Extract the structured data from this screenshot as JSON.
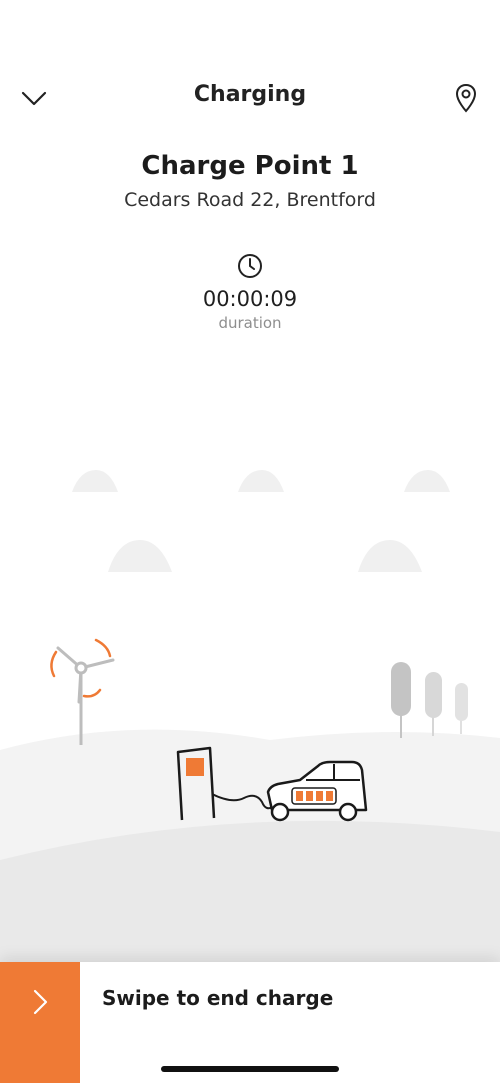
{
  "header": {
    "title": "Charging",
    "back_icon": "chevron-down-icon",
    "location_icon": "map-pin-icon"
  },
  "charge_point": {
    "name": "Charge Point 1",
    "address": "Cedars Road 22, Brentford"
  },
  "session": {
    "duration_icon": "clock-icon",
    "duration": "00:00:09",
    "duration_label": "duration"
  },
  "illustration": {
    "accent_color": "#ef7a35",
    "battery_bars": 4
  },
  "swipe": {
    "label": "Swipe to end charge",
    "icon": "chevron-right-icon",
    "color": "#ef7a35"
  }
}
